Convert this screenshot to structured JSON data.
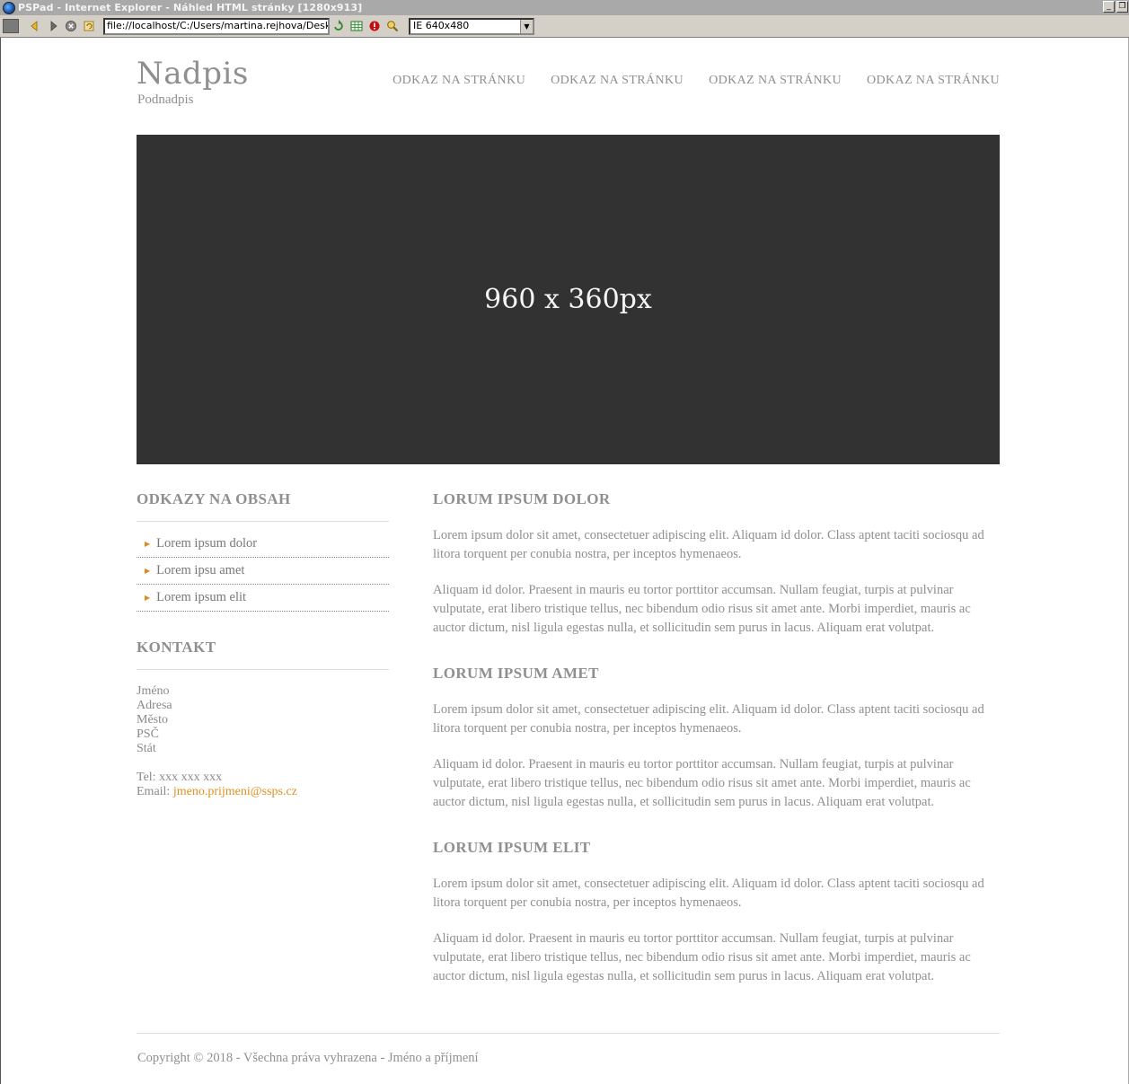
{
  "window": {
    "title": "PSPad - Internet Explorer - Náhled HTML stránky   [1280x913]",
    "min_glyph": "_",
    "restore_glyph": "❐"
  },
  "toolbar": {
    "url": "file://localhost/C:/Users/martina.rejhova/Desktop/E",
    "size_option": "IE 640x480"
  },
  "header": {
    "title": "Nadpis",
    "subtitle": "Podnadpis",
    "nav": [
      "ODKAZ NA STRÁNKU",
      "ODKAZ NA STRÁNKU",
      "ODKAZ NA STRÁNKU",
      "ODKAZ NA STRÁNKU"
    ]
  },
  "hero": {
    "label": "960 x 360px"
  },
  "sidebar": {
    "links_heading": "ODKAZY NA OBSAH",
    "links": [
      "Lorem ipsum dolor",
      "Lorem ipsu amet",
      "Lorem ipsum elit"
    ],
    "contact_heading": "KONTAKT",
    "contact_lines": [
      "Jméno",
      "Adresa",
      "Město",
      "PSČ",
      "Stát"
    ],
    "tel": "Tel: xxx xxx xxx",
    "email_label": "Email: ",
    "email": "jmeno.prijmeni@ssps.cz"
  },
  "sections": [
    {
      "heading": "LORUM IPSUM DOLOR",
      "p1": "Lorem ipsum dolor sit amet, consectetuer adipiscing elit. Aliquam id dolor. Class aptent taciti sociosqu ad litora torquent per conubia nostra, per inceptos hymenaeos.",
      "p2": "Aliquam id dolor. Praesent in mauris eu tortor porttitor accumsan. Nullam feugiat, turpis at pulvinar vulputate, erat libero tristique tellus, nec bibendum odio risus sit amet ante. Morbi imperdiet, mauris ac auctor dictum, nisl ligula egestas nulla, et sollicitudin sem purus in lacus. Aliquam erat volutpat."
    },
    {
      "heading": "LORUM IPSUM AMET",
      "p1": "Lorem ipsum dolor sit amet, consectetuer adipiscing elit. Aliquam id dolor. Class aptent taciti sociosqu ad litora torquent per conubia nostra, per inceptos hymenaeos.",
      "p2": "Aliquam id dolor. Praesent in mauris eu tortor porttitor accumsan. Nullam feugiat, turpis at pulvinar vulputate, erat libero tristique tellus, nec bibendum odio risus sit amet ante. Morbi imperdiet, mauris ac auctor dictum, nisl ligula egestas nulla, et sollicitudin sem purus in lacus. Aliquam erat volutpat."
    },
    {
      "heading": "LORUM IPSUM ELIT",
      "p1": "Lorem ipsum dolor sit amet, consectetuer adipiscing elit. Aliquam id dolor. Class aptent taciti sociosqu ad litora torquent per conubia nostra, per inceptos hymenaeos.",
      "p2": "Aliquam id dolor. Praesent in mauris eu tortor porttitor accumsan. Nullam feugiat, turpis at pulvinar vulputate, erat libero tristique tellus, nec bibendum odio risus sit amet ante. Morbi imperdiet, mauris ac auctor dictum, nisl ligula egestas nulla, et sollicitudin sem purus in lacus. Aliquam erat volutpat."
    }
  ],
  "footer": {
    "text": "Copyright © 2018 - Všechna práva vyhrazena - Jméno a příjmení"
  },
  "colors": {
    "accent": "#e09020",
    "hero_bg": "#323232",
    "text": "#8f8f8f"
  }
}
